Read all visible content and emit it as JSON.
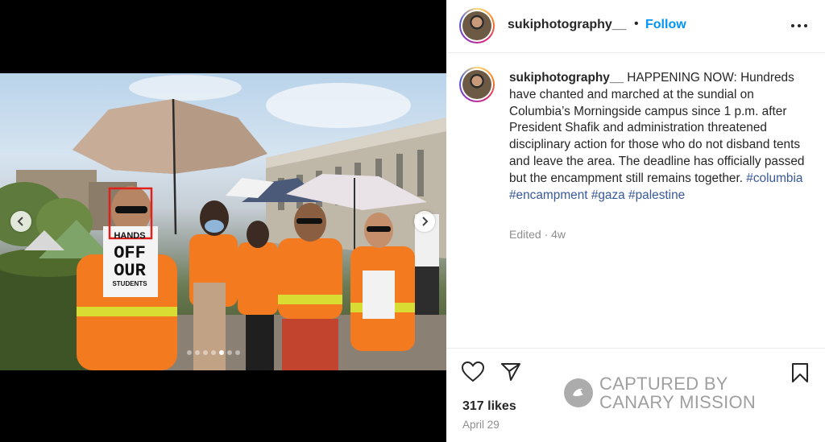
{
  "post": {
    "username": "sukiphotography__",
    "separator": "•",
    "follow_label": "Follow",
    "caption_text": "HAPPENING NOW: Hundreds have chanted and marched at the sundial on Columbia’s Morningside campus since 1 p.m. after President Shafik and administration threatened disciplinary action for those who do not disband tents and leave the area. The deadline has officially passed but the encampment still remains together.",
    "hashtags": [
      "#columbia",
      "#encampment",
      "#gaza",
      "#palestine"
    ],
    "edited_label": "Edited · 4w",
    "likes": "317 likes",
    "date": "April 29"
  },
  "media": {
    "sign_lines": [
      "HANDS",
      "OFF",
      "OUR",
      "STUDENTS"
    ],
    "carousel": {
      "count": 7,
      "active_index": 4
    }
  },
  "watermark": {
    "line1": "CAPTURED BY",
    "line2": "CANARY MISSION"
  },
  "icons": {
    "more": "more-horizontal-icon",
    "like": "heart-icon",
    "share": "paper-plane-icon",
    "save": "bookmark-icon",
    "prev": "chevron-left-icon",
    "next": "chevron-right-icon"
  },
  "colors": {
    "link": "#0095f6",
    "hashtag": "#385898",
    "text": "#262626",
    "muted": "#8e8e8e",
    "vest": "#f47a1f",
    "highlight_box": "#e0201b"
  }
}
